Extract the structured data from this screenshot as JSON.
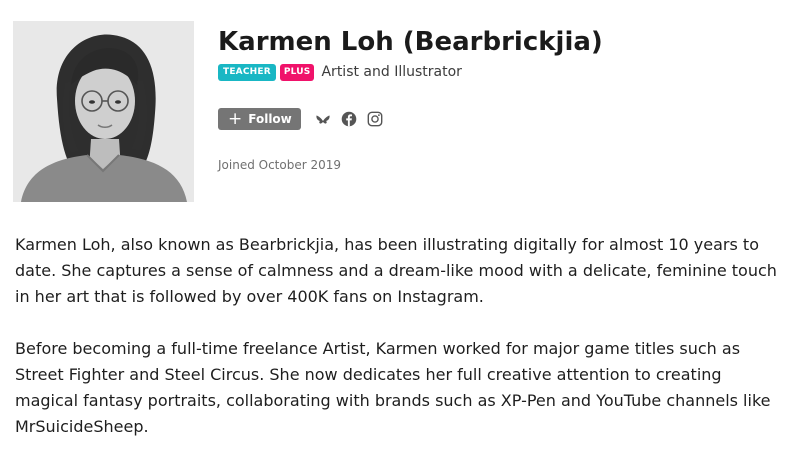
{
  "profile": {
    "name": "Karmen Loh (Bearbrickjia)",
    "badges": {
      "teacher": "TEACHER",
      "plus": "PLUS"
    },
    "role": "Artist and Illustrator",
    "follow_label": "Follow",
    "social_icons": [
      "bluesky-icon",
      "facebook-icon",
      "instagram-icon"
    ],
    "joined": "Joined October 2019"
  },
  "bio": {
    "paragraphs": [
      "Karmen Loh, also known as Bearbrickjia, has been illustrating digitally for almost 10 years to date. She captures a sense of calmness and a dream-like mood with a delicate, feminine touch in her art that is followed by over 400K fans on Instagram.",
      "Before becoming a full-time freelance Artist, Karmen worked for major game titles such as Street Fighter and Steel Circus. She now dedicates her full creative attention to creating magical fantasy portraits, collaborating with brands such as XP-Pen and YouTube channels like MrSuicideSheep."
    ]
  },
  "colors": {
    "teacher_badge": "#19b7c4",
    "plus_badge": "#f0126a",
    "follow_button": "#757575",
    "text": "#1e1e1e",
    "muted": "#707070"
  }
}
